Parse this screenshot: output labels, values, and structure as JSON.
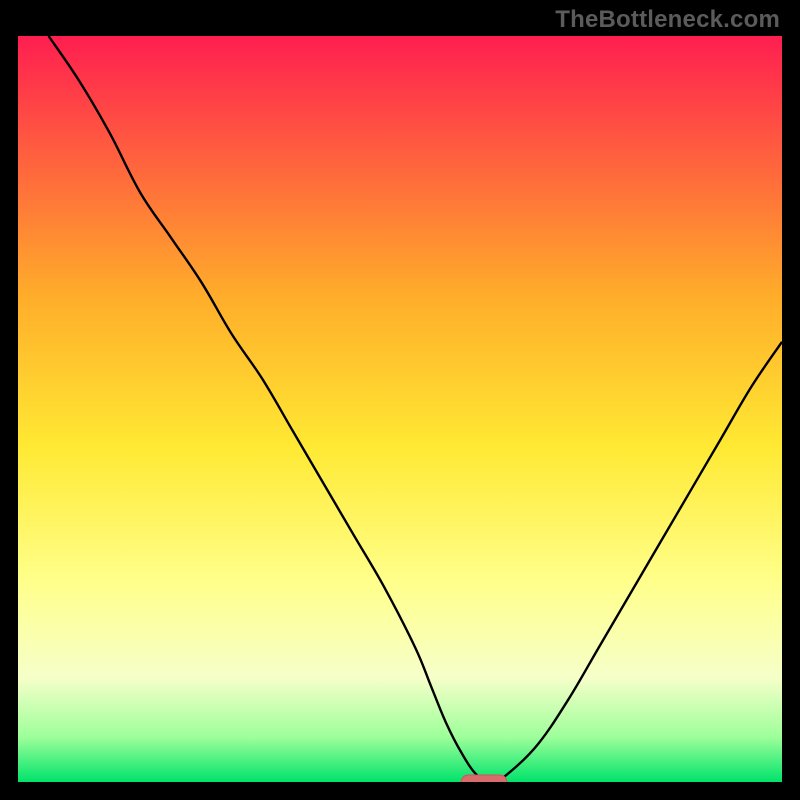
{
  "watermark": "TheBottleneck.com",
  "colors": {
    "frame": "#000000",
    "curve": "#000000",
    "marker_fill": "#d86b6b",
    "marker_stroke": "#c95858",
    "grad_top": "#ff1e50",
    "grad_mid_upper": "#ffad2a",
    "grad_mid": "#ffe933",
    "grad_mid_lower": "#ffff8a",
    "grad_pale": "#f6ffc9",
    "grad_green_light": "#9dff9a",
    "grad_green": "#00e36b"
  },
  "chart_data": {
    "type": "line",
    "title": "",
    "xlabel": "",
    "ylabel": "",
    "xlim": [
      0,
      100
    ],
    "ylim": [
      0,
      100
    ],
    "annotations": [],
    "series": [
      {
        "name": "bottleneck-curve",
        "x": [
          4,
          8,
          12,
          16,
          20,
          24,
          28,
          32,
          36,
          40,
          44,
          48,
          52,
          54,
          56,
          58,
          60,
          62,
          64,
          68,
          72,
          76,
          80,
          84,
          88,
          92,
          96,
          100
        ],
        "y": [
          100,
          94,
          87,
          79,
          73,
          67,
          60,
          54,
          47,
          40,
          33,
          26,
          18,
          13,
          8,
          4,
          1,
          0,
          1,
          5,
          11,
          18,
          25,
          32,
          39,
          46,
          53,
          59
        ]
      }
    ],
    "marker": {
      "x": 61,
      "y": 0,
      "width": 6
    },
    "gradient_stops": [
      {
        "pct": 0,
        "role": "top"
      },
      {
        "pct": 35,
        "role": "mid_upper"
      },
      {
        "pct": 55,
        "role": "mid"
      },
      {
        "pct": 73,
        "role": "mid_lower"
      },
      {
        "pct": 86,
        "role": "pale"
      },
      {
        "pct": 94,
        "role": "green_light"
      },
      {
        "pct": 100,
        "role": "green"
      }
    ]
  }
}
